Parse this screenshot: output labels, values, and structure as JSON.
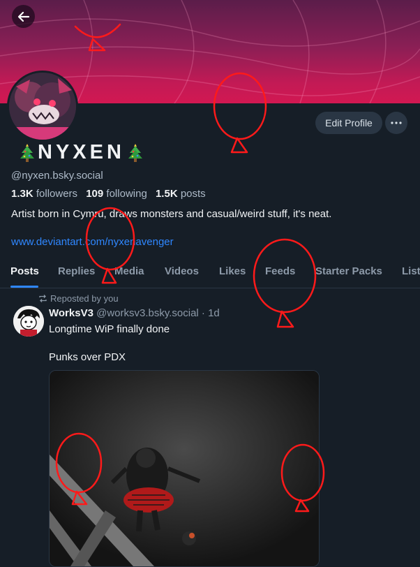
{
  "header": {
    "edit_profile_label": "Edit Profile",
    "more_label": "···"
  },
  "profile": {
    "display_name": "NYXEN",
    "handle": "@nyxen.bsky.social",
    "followers_count": "1.3K",
    "followers_label": "followers",
    "following_count": "109",
    "following_label": "following",
    "posts_count": "1.5K",
    "posts_label": "posts",
    "bio": "Artist born in Cymru, draws monsters and casual/weird stuff, it's neat.",
    "link": "www.deviantart.com/nyxenavenger"
  },
  "tabs": [
    {
      "label": "Posts"
    },
    {
      "label": "Replies"
    },
    {
      "label": "Media"
    },
    {
      "label": "Videos"
    },
    {
      "label": "Likes"
    },
    {
      "label": "Feeds"
    },
    {
      "label": "Starter Packs"
    },
    {
      "label": "Lists"
    }
  ],
  "feed": {
    "post": {
      "repost_label": "Reposted by you",
      "author_name": "WorksV3",
      "author_handle": "@worksv3.bsky.social",
      "separator": "·",
      "age": "1d",
      "text_line1": "Longtime WiP finally done",
      "text_line2": "Punks over PDX"
    }
  },
  "colors": {
    "background": "#161e27",
    "accent": "#2f87ff",
    "banner": "#c21a55",
    "doodle": "#ff1a1a"
  }
}
